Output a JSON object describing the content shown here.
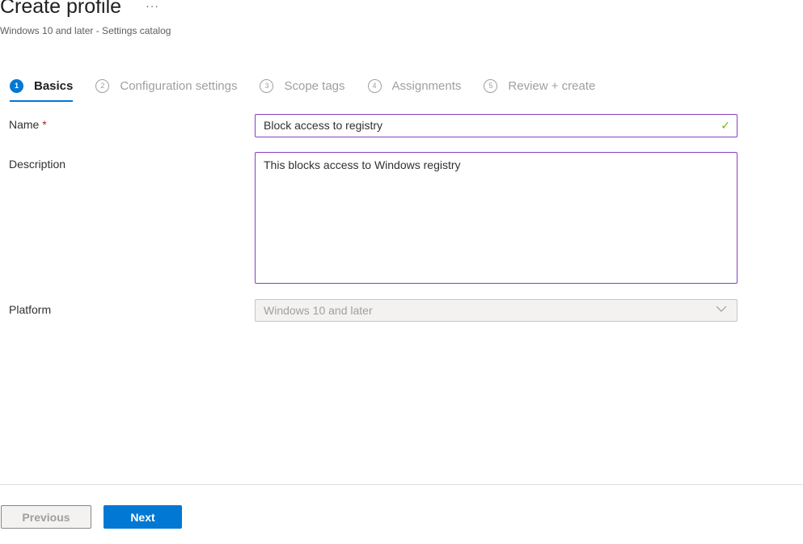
{
  "header": {
    "title": "Create profile",
    "more": "···",
    "subtitle": "Windows 10 and later - Settings catalog"
  },
  "tabs": [
    {
      "num": "1",
      "label": "Basics",
      "active": true
    },
    {
      "num": "2",
      "label": "Configuration settings",
      "active": false
    },
    {
      "num": "3",
      "label": "Scope tags",
      "active": false
    },
    {
      "num": "4",
      "label": "Assignments",
      "active": false
    },
    {
      "num": "5",
      "label": "Review + create",
      "active": false
    }
  ],
  "form": {
    "name_label": "Name",
    "required_mark": "*",
    "name_value": "Block access to registry",
    "valid_mark": "✓",
    "description_label": "Description",
    "description_value": "This blocks access to Windows registry",
    "platform_label": "Platform",
    "platform_value": "Windows 10 and later"
  },
  "footer": {
    "previous_label": "Previous",
    "next_label": "Next"
  },
  "colors": {
    "accent": "#0078d4",
    "input_focus_border": "#8a3fbf",
    "valid": "#6bb700",
    "required": "#a4262c"
  }
}
